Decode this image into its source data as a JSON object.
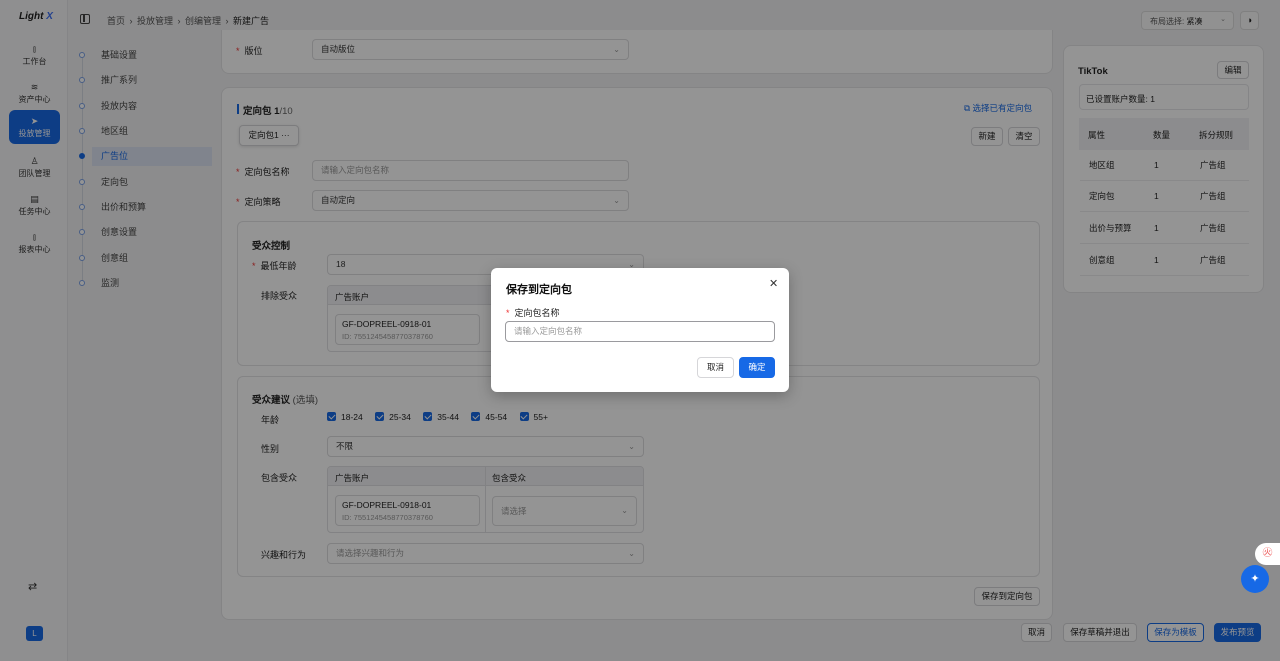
{
  "logo": {
    "text": "Light",
    "accent": "X"
  },
  "nav": [
    {
      "icon": "chart-bar-icon",
      "glyph": "⫾",
      "label": "工作台"
    },
    {
      "icon": "layers-icon",
      "glyph": "≋",
      "label": "资产中心"
    },
    {
      "icon": "send-icon",
      "glyph": "➤",
      "label": "投放管理"
    },
    {
      "icon": "users-icon",
      "glyph": "♙",
      "label": "团队管理"
    },
    {
      "icon": "clipboard-icon",
      "glyph": "▤",
      "label": "任务中心"
    },
    {
      "icon": "report-icon",
      "glyph": "⫾",
      "label": "报表中心"
    }
  ],
  "user_initial": "L",
  "breadcrumb": [
    "首页",
    "投放管理",
    "创编管理",
    "新建广告"
  ],
  "layout_select": {
    "label": "布局选择:",
    "value": "紧凑"
  },
  "steps": [
    "基础设置",
    "推广系列",
    "投放内容",
    "地区组",
    "广告位",
    "定向包",
    "出价和预算",
    "创意设置",
    "创意组",
    "监测"
  ],
  "active_step": 4,
  "placement": {
    "label": "版位",
    "value": "自动版位"
  },
  "targeting": {
    "title": "定向包",
    "count": "1",
    "total": "/10",
    "select_existing": "选择已有定向包",
    "tab": "定向包1",
    "tab_more": "···",
    "new_btn": "新建",
    "clear_btn": "清空",
    "name_label": "定向包名称",
    "name_placeholder": "请输入定向包名称",
    "strategy_label": "定向策略",
    "strategy_value": "自动定向",
    "audience_control": {
      "title": "受众控制",
      "min_age_label": "最低年龄",
      "min_age_value": "18",
      "exclude_label": "排除受众",
      "table_header": "广告账户",
      "account_name": "GF-DOPREEL-0918-01",
      "account_id": "ID: 7551245458770378760"
    },
    "audience_suggest": {
      "title": "受众建议",
      "optional": "(选填)",
      "age_label": "年龄",
      "ages": [
        "18-24",
        "25-34",
        "35-44",
        "45-54",
        "55+"
      ],
      "gender_label": "性别",
      "gender_value": "不限",
      "include_label": "包含受众",
      "col_account": "广告账户",
      "col_include": "包含受众",
      "account_name": "GF-DOPREEL-0918-01",
      "account_id": "ID: 7551245458770378760",
      "include_placeholder": "请选择",
      "interest_label": "兴趣和行为",
      "interest_placeholder": "请选择兴趣和行为"
    },
    "save_to_package": "保存到定向包"
  },
  "footer": {
    "cancel": "取消",
    "save_draft": "保存草稿并退出",
    "save_template": "保存为模板",
    "publish": "发布预览"
  },
  "right_panel": {
    "title": "TikTok",
    "edit": "编辑",
    "accounts_set": "已设置账户数量: 1",
    "headers": [
      "属性",
      "数量",
      "拆分规则"
    ],
    "rows": [
      [
        "地区组",
        "1",
        "广告组"
      ],
      [
        "定向包",
        "1",
        "广告组"
      ],
      [
        "出价与预算",
        "1",
        "广告组"
      ],
      [
        "创意组",
        "1",
        "广告组"
      ]
    ]
  },
  "modal": {
    "title": "保存到定向包",
    "field_label": "定向包名称",
    "placeholder": "请输入定向包名称",
    "cancel": "取消",
    "confirm": "确定"
  },
  "colors": {
    "primary": "#1769e6",
    "required": "#e33333"
  }
}
